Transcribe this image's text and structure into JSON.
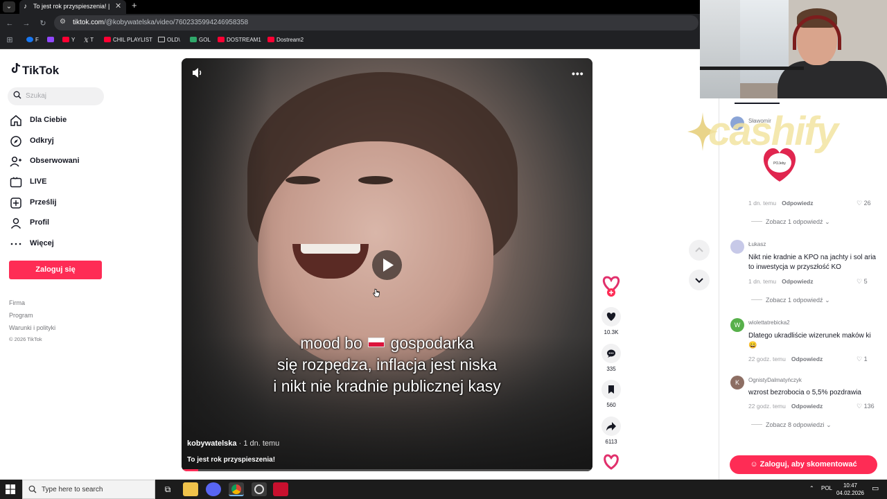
{
  "browser": {
    "tab_title": "To jest rok przyspieszenia! | TikTok",
    "url_host": "tiktok.com",
    "url_path": "/@kobywatelska/video/7602335994246958358",
    "bookmarks": [
      "F",
      "Y",
      "T",
      "CHIL PLAYLIST",
      "OLD\\",
      "GOL",
      "DOSTREAM1",
      "Dostream2"
    ]
  },
  "sidebar": {
    "logo": "TikTok",
    "search_placeholder": "Szukaj",
    "items": [
      {
        "label": "Dla Ciebie",
        "icon": "home-icon"
      },
      {
        "label": "Odkryj",
        "icon": "compass-icon"
      },
      {
        "label": "Obserwowani",
        "icon": "user-follow-icon"
      },
      {
        "label": "LIVE",
        "icon": "live-icon"
      },
      {
        "label": "Prześlij",
        "icon": "upload-icon"
      },
      {
        "label": "Profil",
        "icon": "profile-icon"
      },
      {
        "label": "Więcej",
        "icon": "more-icon"
      }
    ],
    "login_button": "Zaloguj się",
    "footer_links": [
      "Firma",
      "Program",
      "Warunki i polityki"
    ],
    "copyright": "© 2026 TikTok"
  },
  "video": {
    "caption_line1_a": "mood bo",
    "caption_line1_b": "gospodarka",
    "caption_line2": "się rozpędza, inflacja jest niska",
    "caption_line3": "i nikt nie kradnie publicznej kasy",
    "author": "kobywatelska",
    "time": "· 1 dn. temu",
    "description": "To jest rok przyspieszenia!",
    "progress": 0.04,
    "accent": "#fe2c55"
  },
  "actions": {
    "likes": "10.3K",
    "comments": "335",
    "saves": "560",
    "shares": "6113"
  },
  "overlay": {
    "sponsor_text": "cashify",
    "heart_badge_text": "POJeby"
  },
  "comments": [
    {
      "user": "Sławomir",
      "text": "",
      "time": "1 dn. temu",
      "reply": "Odpowiedz",
      "likes": "26",
      "more": "Zobacz 1 odpowiedź"
    },
    {
      "user": "Łukasz",
      "text": "Nikt nie kradnie a KPO na jachty i sol aria to inwestycja w przyszłość KO",
      "time": "1 dn. temu",
      "reply": "Odpowiedz",
      "likes": "5",
      "more": "Zobacz 1 odpowiedź"
    },
    {
      "user": "wiolettatrebicka2",
      "text": "Dlatego ukradliście wizerunek maków ki 😄",
      "time": "22 godz. temu",
      "reply": "Odpowiedz",
      "likes": "1",
      "more": ""
    },
    {
      "user": "OgnistyDalmatyńczyk",
      "text": "wzrost bezrobocia o 5,5% pozdrawia",
      "time": "22 godz. temu",
      "reply": "Odpowiedz",
      "likes": "136",
      "more": "Zobacz 8 odpowiedzi"
    }
  ],
  "comment_login": "Zaloguj, aby skomentować",
  "taskbar": {
    "search_text": "Type here to search",
    "lang": "POL",
    "time": "10:47",
    "date": "04.02.2026"
  }
}
